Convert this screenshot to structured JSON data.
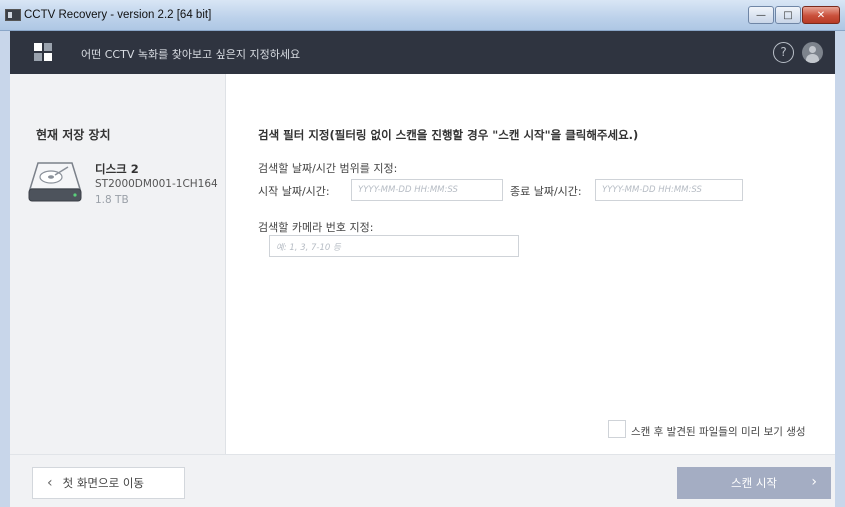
{
  "window": {
    "title": "CCTV Recovery - version 2.2 [64 bit]",
    "buttons": {
      "minimize": "—",
      "maximize": "□",
      "close": "✕"
    }
  },
  "header": {
    "text": "어떤 CCTV 녹화를 찾아보고 싶은지 지정하세요",
    "icons": [
      "grid-icon",
      "help-icon",
      "user-icon"
    ],
    "help_glyph": "?"
  },
  "left_panel": {
    "title": "현재 저장 장치",
    "disk": {
      "name": "디스크 2",
      "model": "ST2000DM001-1CH164",
      "size": "1.8 TB"
    }
  },
  "content": {
    "title": "검색 필터 지정(필터링 없이 스캔을 진행할 경우 \"스캔 시작\"을 클릭해주세요.)",
    "date_range_label": "검색할 날짜/시간 범위를 지정:",
    "start_label": "시작 날짜/시간:",
    "start_placeholder": "YYYY-MM-DD HH:MM:SS",
    "end_label": "종료 날짜/시간:",
    "end_placeholder": "YYYY-MM-DD HH:MM:SS",
    "camera_label": "검색할 카메라 번호 지정:",
    "camera_placeholder": "예: 1, 3, 7-10 등",
    "preview_label": "스캔 후 발견된 파일들의 미리 보기 생성",
    "preview_checked": false
  },
  "footer": {
    "back_label": "첫 화면으로 이동",
    "back_glyph": "‹",
    "scan_label": "스캔 시작",
    "scan_glyph": "›"
  },
  "colors": {
    "header_bg": "#2f3440",
    "panel_bg": "#f1f2f4",
    "scan_button": "#a4adc3"
  }
}
